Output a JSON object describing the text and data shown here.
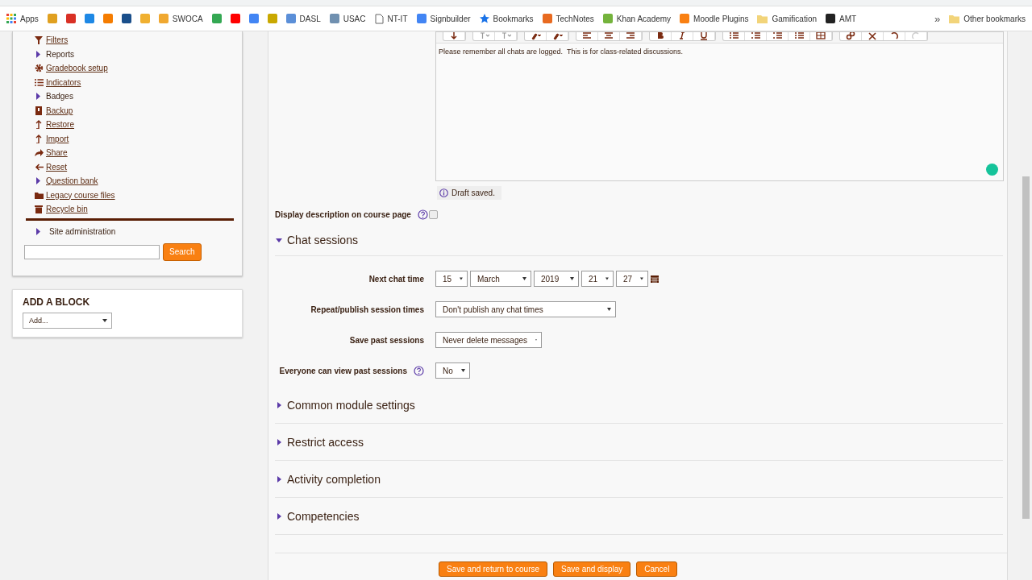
{
  "bookmarks": [
    {
      "label": "Apps",
      "kind": "apps"
    },
    {
      "kind": "favicon",
      "color": "#e0a020"
    },
    {
      "kind": "favicon",
      "color": "#d93025"
    },
    {
      "kind": "favicon",
      "color": "#1e88e5"
    },
    {
      "kind": "favicon",
      "color": "#f57c00"
    },
    {
      "kind": "favicon",
      "color": "#1a4f8b"
    },
    {
      "kind": "favicon",
      "color": "#f0b030"
    },
    {
      "label": "SWOCA",
      "kind": "favicon",
      "color": "#f0a830"
    },
    {
      "kind": "favicon",
      "color": "#34a853"
    },
    {
      "kind": "favicon",
      "color": "#ff0000"
    },
    {
      "kind": "favicon",
      "color": "#4285f4"
    },
    {
      "kind": "favicon",
      "color": "#c9a800"
    },
    {
      "label": "DASL",
      "kind": "favicon",
      "color": "#5b8fd8"
    },
    {
      "label": "USAC",
      "kind": "favicon",
      "color": "#7090b0"
    },
    {
      "label": "NT-IT",
      "kind": "page"
    },
    {
      "label": "Signbuilder",
      "kind": "favicon",
      "color": "#4285f4"
    },
    {
      "label": "Bookmarks",
      "kind": "star",
      "color": "#1a73e8"
    },
    {
      "label": "TechNotes",
      "kind": "favicon",
      "color": "#e86a20"
    },
    {
      "label": "Khan Academy",
      "kind": "favicon",
      "color": "#74b33c"
    },
    {
      "label": "Moodle Plugins",
      "kind": "favicon",
      "color": "#f98012"
    },
    {
      "label": "Gamification",
      "kind": "folder",
      "color": "#f2d47a"
    },
    {
      "label": "AMT",
      "kind": "favicon",
      "color": "#222222"
    }
  ],
  "more_bookmarks": "»",
  "other_bookmarks": {
    "label": "Other bookmarks",
    "kind": "folder",
    "color": "#f2d47a"
  },
  "sidebar": {
    "items": [
      {
        "label": "Filters",
        "link": true
      },
      {
        "label": "Reports",
        "link": false
      },
      {
        "label": "Gradebook setup",
        "link": true
      },
      {
        "label": "Indicators",
        "link": true
      },
      {
        "label": "Badges",
        "link": false
      },
      {
        "label": "Backup",
        "link": true
      },
      {
        "label": "Restore",
        "link": true
      },
      {
        "label": "Import",
        "link": true
      },
      {
        "label": "Share",
        "link": true
      },
      {
        "label": "Reset",
        "link": true
      },
      {
        "label": "Question bank",
        "link": true
      },
      {
        "label": "Legacy course files",
        "link": true
      },
      {
        "label": "Recycle bin",
        "link": true
      }
    ],
    "site_admin": "Site administration",
    "search_button": "Search"
  },
  "add_block": {
    "title": "ADD A BLOCK",
    "select": "Add..."
  },
  "editor": {
    "text": "Please remember all chats are logged.  This is for class-related discussions.",
    "draft": "Draft saved."
  },
  "display_description": {
    "label": "Display description on course page",
    "checked": false
  },
  "chat_sessions": {
    "title": "Chat sessions",
    "expanded": true,
    "next_chat_time": {
      "label": "Next chat time",
      "parts": [
        "15",
        "March",
        "2019",
        "21",
        "27"
      ]
    },
    "fields": [
      {
        "label": "Repeat/publish session times",
        "value": "Don't publish any chat times",
        "help": false
      },
      {
        "label": "Save past sessions",
        "value": "Never delete messages",
        "help": false
      },
      {
        "label": "Everyone can view past sessions",
        "value": "No",
        "help": true
      }
    ]
  },
  "sections": [
    {
      "title": "Common module settings",
      "expanded": false
    },
    {
      "title": "Restrict access",
      "expanded": false
    },
    {
      "title": "Activity completion",
      "expanded": false
    },
    {
      "title": "Competencies",
      "expanded": false
    }
  ],
  "buttons": [
    "Save and return to course",
    "Save and display",
    "Cancel"
  ]
}
